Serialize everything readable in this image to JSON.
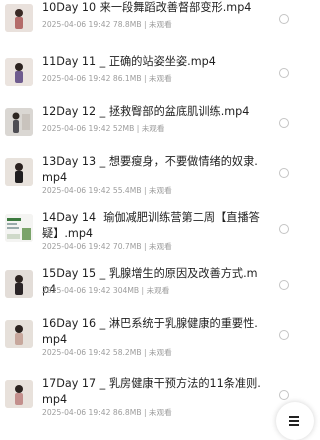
{
  "files": [
    {
      "name": "10Day 10 来一段舞蹈改善督部变形.mp4",
      "date": "2025-04-06 19:42",
      "size": "78.8MB",
      "status": "未观看"
    },
    {
      "name": "11Day 11 _ 正确的站姿坐姿.mp4",
      "date": "2025-04-06 19:42",
      "size": "86.1MB",
      "status": "未观看"
    },
    {
      "name": "12Day 12 _ 拯救臀部的盆底肌训练.mp4",
      "date": "2025-04-06 19:42",
      "size": "52MB",
      "status": "未观看"
    },
    {
      "name": "13Day 13 _ 想要瘦身，不要做情绪的奴隶.mp4",
      "date": "2025-04-06 19:42",
      "size": "55.4MB",
      "status": "未观看"
    },
    {
      "name": "14Day 14  瑜伽减肥训练营第二周【直播答疑】.mp4",
      "date": "2025-04-06 19:42",
      "size": "70.7MB",
      "status": "未观看"
    },
    {
      "name": "15Day 15 _ 乳腺增生的原因及改善方式.mp4",
      "date": "2025-04-06 19:42",
      "size": "304MB",
      "status": "未观看"
    },
    {
      "name": "16Day 16 _ 淋巴系统于乳腺健康的重要性.mp4",
      "date": "2025-04-06 19:42",
      "size": "58.2MB",
      "status": "未观看"
    },
    {
      "name": "17Day 17 _ 乳房健康干预方法的11条准则.mp4",
      "date": "2025-04-06 19:42",
      "size": "86.8MB",
      "status": "未观看"
    }
  ],
  "fab_icon": "menu-icon"
}
